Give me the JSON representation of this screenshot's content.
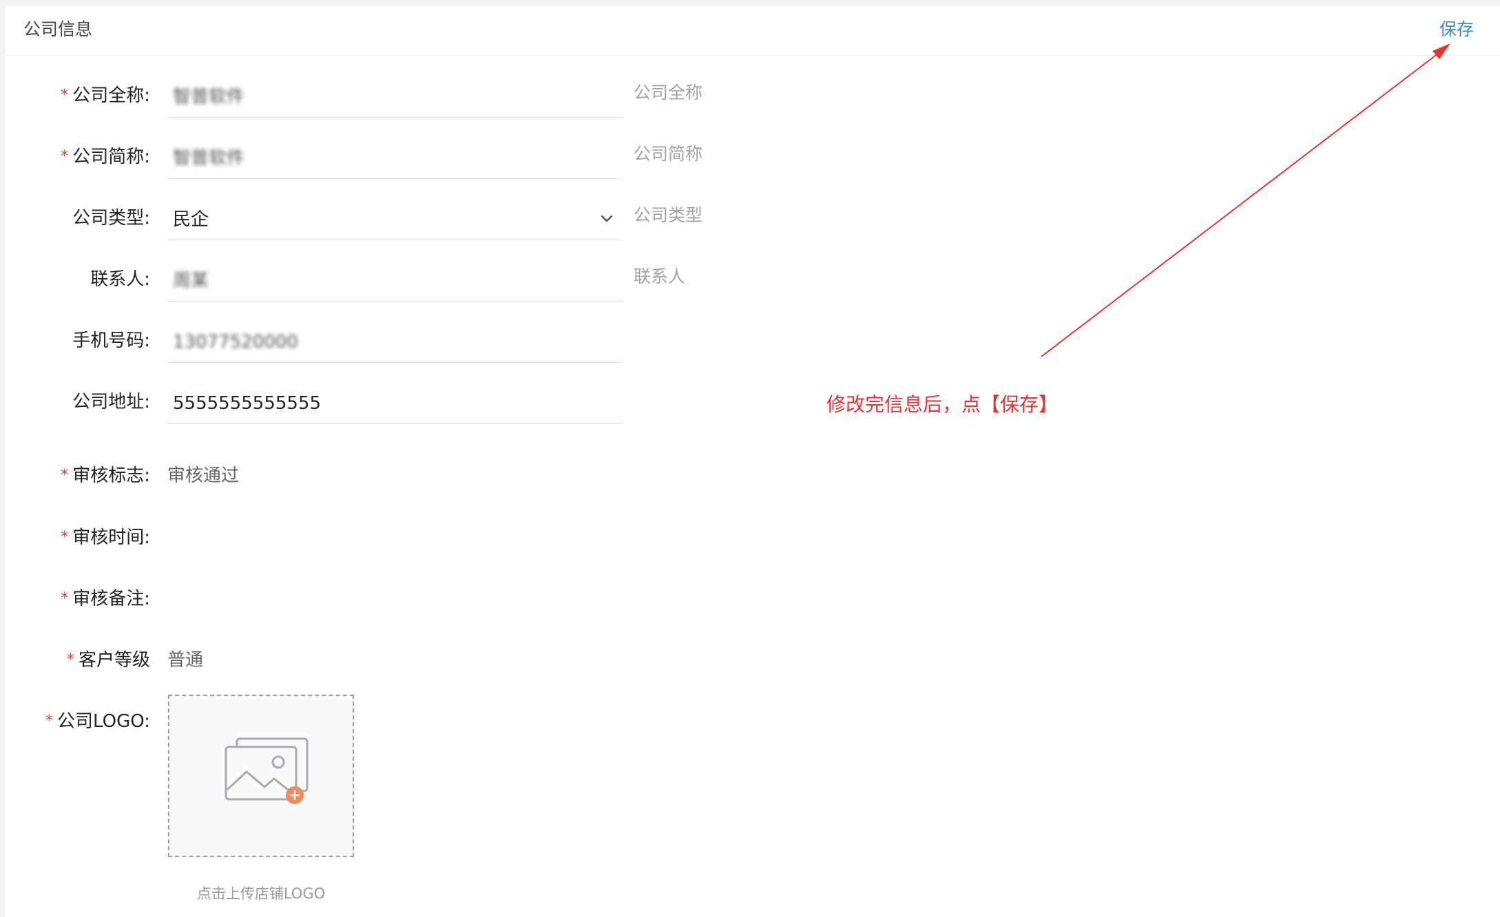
{
  "header": {
    "title": "公司信息",
    "save_label": "保存"
  },
  "form": {
    "required_mark": "*",
    "full_name": {
      "label": "公司全称:",
      "value": "智普软件",
      "hint": "公司全称"
    },
    "short_name": {
      "label": "公司简称:",
      "value": "智普软件",
      "hint": "公司简称"
    },
    "company_type": {
      "label": "公司类型:",
      "value": "民企",
      "hint": "公司类型"
    },
    "contact": {
      "label": "联系人:",
      "value": "周某",
      "hint": "联系人"
    },
    "phone": {
      "label": "手机号码:",
      "value": "13077520000"
    },
    "address": {
      "label": "公司地址:",
      "value": "5555555555555"
    },
    "audit_flag": {
      "label": "审核标志:",
      "value": "审核通过"
    },
    "audit_time": {
      "label": "审核时间:",
      "value": ""
    },
    "audit_remark": {
      "label": "审核备注:",
      "value": ""
    },
    "customer_level": {
      "label": "客户等级",
      "value": "普通"
    },
    "logo": {
      "label": "公司LOGO:",
      "caption": "点击上传店铺LOGO"
    }
  },
  "annotation": {
    "text": "修改完信息后，点【保存】",
    "color": "#e93030"
  },
  "icons": {
    "dropdown": "chevron-down-icon",
    "upload": "image-add-icon"
  }
}
